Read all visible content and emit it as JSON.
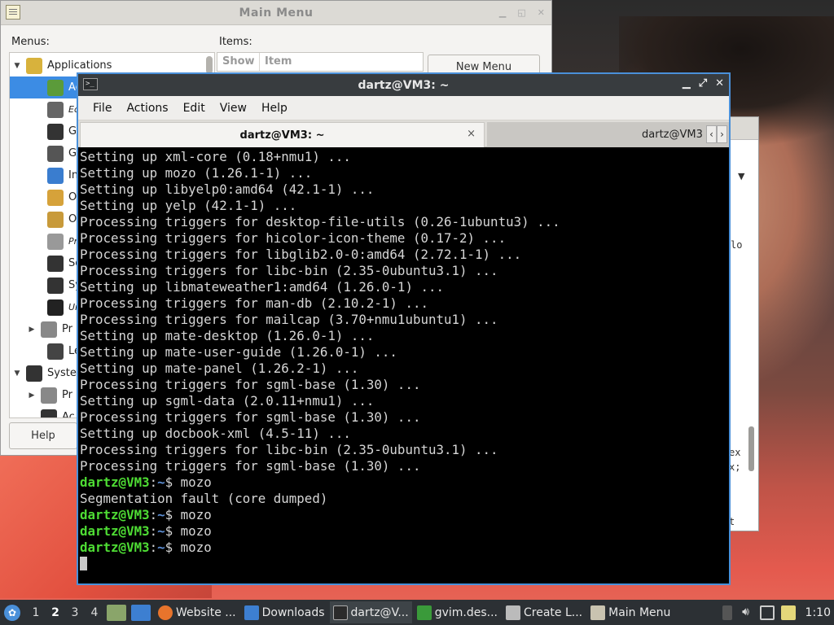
{
  "colors": {
    "terminal_bg": "#000000",
    "terminal_text": "#d6d6d6",
    "prompt_user": "#4edc34",
    "prompt_path": "#5d8fd6",
    "selection": "#3c8ce4",
    "taskbar_bg": "#2c3034"
  },
  "main_menu": {
    "title": "Main Menu",
    "menus_label": "Menus:",
    "items_label": "Items:",
    "columns": {
      "show": "Show",
      "item": "Item"
    },
    "new_menu_label": "New Menu",
    "help_label": "Help",
    "tree": [
      {
        "label": "Applications",
        "icon": "applications-icon"
      },
      {
        "label": "Ac",
        "icon": "accessories-icon"
      },
      {
        "label": "Ed",
        "icon": "education-icon"
      },
      {
        "label": "Ga",
        "icon": "games-icon"
      },
      {
        "label": "Gr",
        "icon": "graphics-icon"
      },
      {
        "label": "Int",
        "icon": "internet-icon"
      },
      {
        "label": "Of",
        "icon": "office-icon"
      },
      {
        "label": "Ot",
        "icon": "other-icon"
      },
      {
        "label": "Pro",
        "icon": "programming-icon"
      },
      {
        "label": "So",
        "icon": "sound-video-icon"
      },
      {
        "label": "Sy",
        "icon": "system-tools-icon"
      },
      {
        "label": "Un",
        "icon": "universal-access-icon"
      },
      {
        "label": "Pr",
        "icon": "preferences-icon"
      },
      {
        "label": "Le",
        "icon": "logout-icon"
      },
      {
        "label": "Syste",
        "icon": "system-icon"
      },
      {
        "label": "Pr",
        "icon": "preferences-icon"
      },
      {
        "label": "Ac",
        "icon": "administration-icon"
      }
    ]
  },
  "window2": {
    "fragments": [
      "lo",
      "ex",
      "x;",
      "t"
    ]
  },
  "terminal": {
    "title": "dartz@VM3: ~",
    "menu": [
      "File",
      "Actions",
      "Edit",
      "View",
      "Help"
    ],
    "tabs": [
      "dartz@VM3: ~",
      "dartz@VM3"
    ],
    "tab_close": "×",
    "lines": [
      "Setting up xml-core (0.18+nmu1) ...",
      "Setting up mozo (1.26.1-1) ...",
      "Setting up libyelp0:amd64 (42.1-1) ...",
      "Setting up yelp (42.1-1) ...",
      "Processing triggers for desktop-file-utils (0.26-1ubuntu3) ...",
      "Processing triggers for hicolor-icon-theme (0.17-2) ...",
      "Processing triggers for libglib2.0-0:amd64 (2.72.1-1) ...",
      "Processing triggers for libc-bin (2.35-0ubuntu3.1) ...",
      "Setting up libmateweather1:amd64 (1.26.0-1) ...",
      "Processing triggers for man-db (2.10.2-1) ...",
      "Processing triggers for mailcap (3.70+nmu1ubuntu1) ...",
      "Setting up mate-desktop (1.26.0-1) ...",
      "Setting up mate-user-guide (1.26.0-1) ...",
      "Setting up mate-panel (1.26.2-1) ...",
      "Processing triggers for sgml-base (1.30) ...",
      "Setting up sgml-data (2.0.11+nmu1) ...",
      "Processing triggers for sgml-base (1.30) ...",
      "Setting up docbook-xml (4.5-11) ...",
      "Processing triggers for libc-bin (2.35-0ubuntu3.1) ...",
      "Processing triggers for sgml-base (1.30) ..."
    ],
    "prompt_user": "dartz@VM3",
    "prompt_sep": ":",
    "prompt_path": "~",
    "prompt_sigil": "$ ",
    "session": [
      {
        "cmd": "mozo",
        "output": "Segmentation fault (core dumped)"
      },
      {
        "cmd": "mozo",
        "output": null
      },
      {
        "cmd": "mozo",
        "output": null
      },
      {
        "cmd": "mozo",
        "output": null
      }
    ]
  },
  "taskbar": {
    "workspaces": [
      "1",
      "2",
      "3",
      "4"
    ],
    "active_workspace": "2",
    "tasks": [
      {
        "label": "Website ...",
        "icon": "firefox-icon"
      },
      {
        "label": "Downloads",
        "icon": "folder-icon"
      },
      {
        "label": "dartz@V...",
        "icon": "terminal-icon"
      },
      {
        "label": "gvim.des...",
        "icon": "vim-icon"
      },
      {
        "label": "Create L...",
        "icon": "launcher-icon"
      },
      {
        "label": "Main Menu",
        "icon": "main-menu-icon"
      }
    ],
    "clock": "1:10"
  }
}
